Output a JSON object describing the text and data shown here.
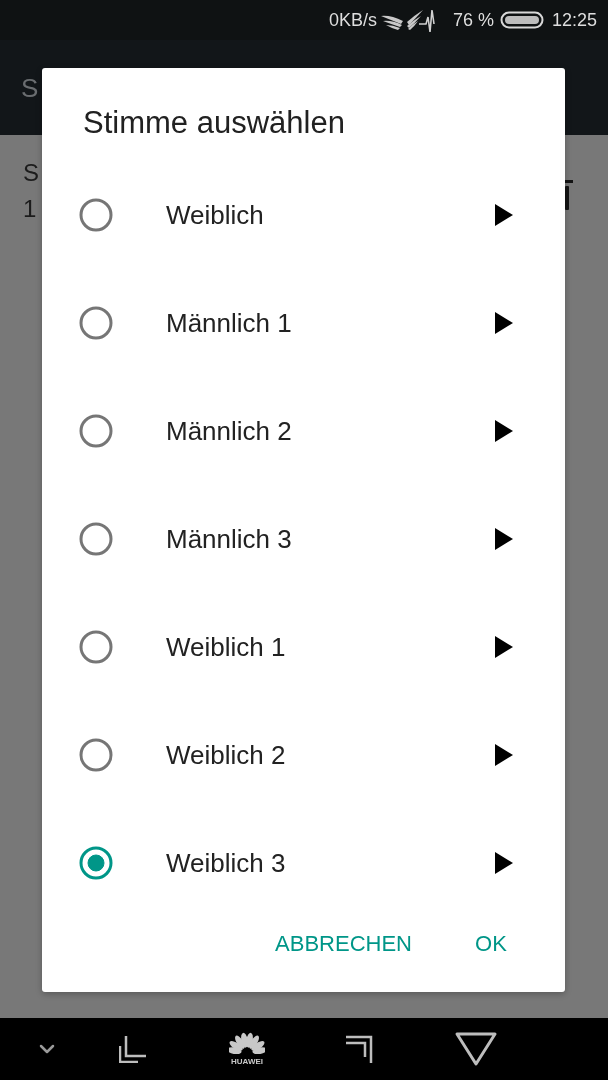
{
  "status_bar": {
    "network_speed": "0KB/s",
    "battery": "76 %",
    "time": "12:25"
  },
  "app_bar": {
    "title": "S"
  },
  "content": {
    "lines": [
      "S",
      "1"
    ]
  },
  "dialog": {
    "title": "Stimme auswählen",
    "options": [
      {
        "label": "Weiblich",
        "selected": false
      },
      {
        "label": "Männlich 1",
        "selected": false
      },
      {
        "label": "Männlich 2",
        "selected": false
      },
      {
        "label": "Männlich 3",
        "selected": false
      },
      {
        "label": "Weiblich 1",
        "selected": false
      },
      {
        "label": "Weiblich 2",
        "selected": false
      },
      {
        "label": "Weiblich 3",
        "selected": true
      }
    ],
    "buttons": [
      {
        "label": "ABBRECHEN"
      },
      {
        "label": "OK"
      }
    ]
  },
  "nav_bar": {
    "logo_text": "HUAWEI"
  }
}
